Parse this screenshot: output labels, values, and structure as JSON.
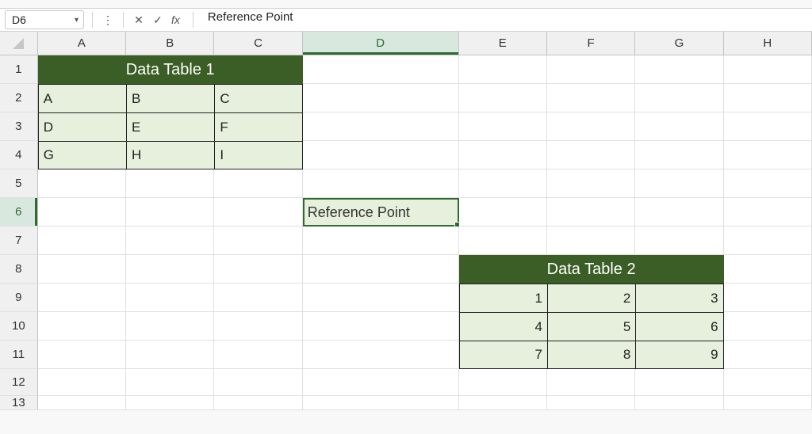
{
  "formula_bar": {
    "cell_ref": "D6",
    "fx_label": "fx",
    "formula": "Reference Point"
  },
  "columns": [
    "A",
    "B",
    "C",
    "D",
    "E",
    "F",
    "G",
    "H"
  ],
  "active_column": "D",
  "rows": [
    1,
    2,
    3,
    4,
    5,
    6,
    7,
    8,
    9,
    10,
    11,
    12,
    13
  ],
  "active_row": 6,
  "table1": {
    "title": "Data Table 1",
    "r2": {
      "A": "A",
      "B": "B",
      "C": "C"
    },
    "r3": {
      "A": "D",
      "B": "E",
      "C": "F"
    },
    "r4": {
      "A": "G",
      "B": "H",
      "C": "I"
    }
  },
  "d6": "Reference Point",
  "table2": {
    "title": "Data Table 2",
    "r9": {
      "E": "1",
      "F": "2",
      "G": "3"
    },
    "r10": {
      "E": "4",
      "F": "5",
      "G": "6"
    },
    "r11": {
      "E": "7",
      "F": "8",
      "G": "9"
    }
  }
}
